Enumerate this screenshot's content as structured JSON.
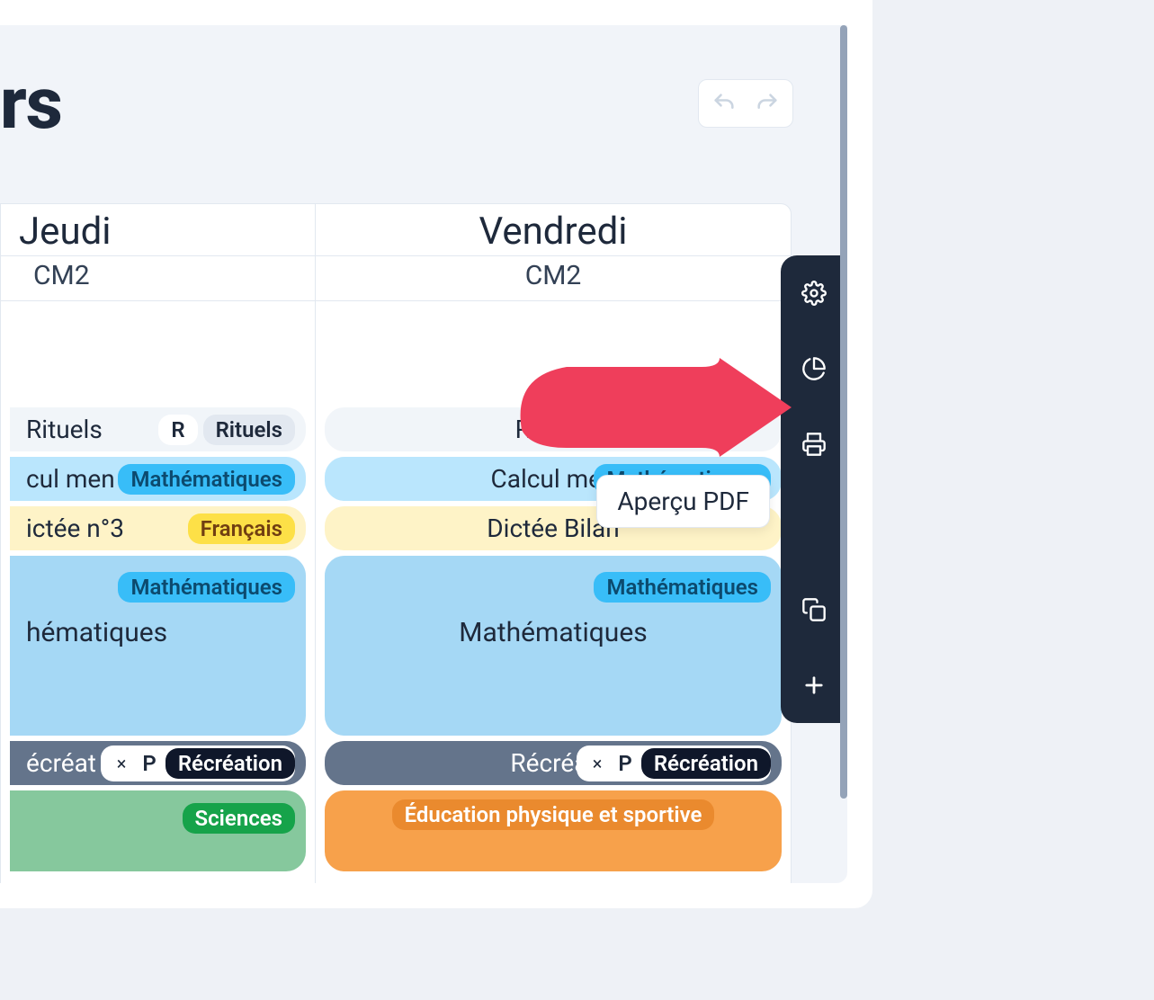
{
  "page_title_fragment": "rs",
  "tooltip": "Aperçu PDF",
  "days": [
    {
      "name": "Jeudi",
      "class": "CM2"
    },
    {
      "name": "Vendredi",
      "class": "CM2"
    }
  ],
  "thursday": {
    "rituels": {
      "title": "Rituels",
      "badge": "R",
      "tag": "Rituels"
    },
    "calcul": {
      "title": "cul men",
      "tag": "Mathématiques"
    },
    "dictee": {
      "title": "ictée n°3",
      "tag": "Français"
    },
    "maths": {
      "title": "hématiques",
      "tag": "Mathématiques"
    },
    "recre": {
      "title": "écréat",
      "p": "P",
      "tag": "Récréation"
    },
    "sciences": {
      "tag": "Sciences"
    }
  },
  "friday": {
    "rituels": {
      "title": "Rituels"
    },
    "calcul": {
      "title": "Calcul men",
      "tag": "Mathématiques"
    },
    "dictee": {
      "title": "Dictée Bilan"
    },
    "maths": {
      "title": "Mathématiques",
      "tag": "Mathématiques"
    },
    "recre": {
      "title": "Récréat",
      "p": "P",
      "tag": "Récréation"
    },
    "eps": {
      "title": "Éducation physique et sportive"
    }
  }
}
